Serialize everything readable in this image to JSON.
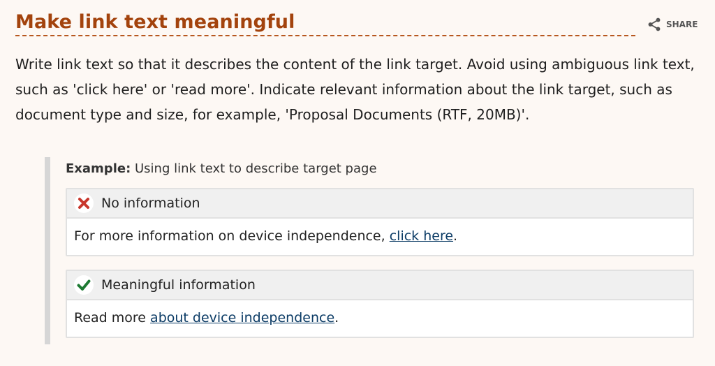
{
  "section": {
    "title": "Make link text meaningful",
    "share_label": "SHARE",
    "intro": "Write link text so that it describes the content of the link target. Avoid using ambiguous link text, such as 'click here' or 'read more'. Indicate relevant information about the link target, such as document type and size, for example, 'Proposal Documents (RTF, 20MB)'."
  },
  "example": {
    "caption_label": "Example:",
    "caption_text": " Using link text to describe target page",
    "bad": {
      "icon": "cross-icon",
      "heading": "No information",
      "text_before": "For more information on device independence, ",
      "link": "click here",
      "text_after": "."
    },
    "good": {
      "icon": "check-icon",
      "heading": "Meaningful information",
      "text_before": "Read more ",
      "link": "about device independence",
      "text_after": "."
    }
  },
  "colors": {
    "page_bg": "#fdf8f4",
    "title": "#a3430d",
    "link": "#0b3b65",
    "bad_icon": "#c8372d",
    "good_icon": "#1e7a33"
  }
}
